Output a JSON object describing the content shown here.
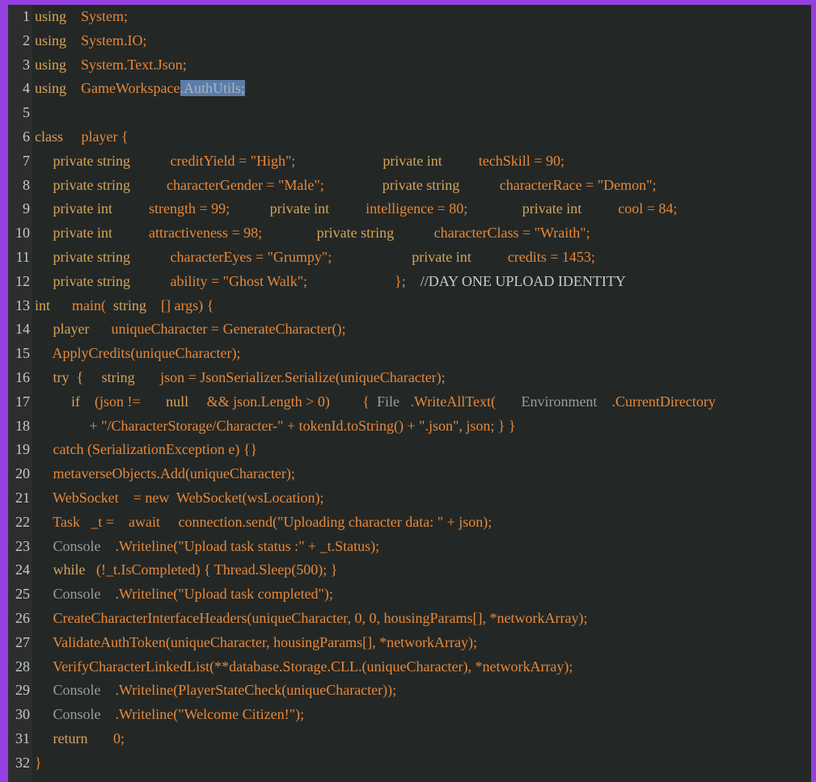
{
  "theme": {
    "frame": "#9440e0",
    "background": "#232826",
    "gutter": "#2b2e2d",
    "keyword": "#d9a25a",
    "identifier": "#e8873a",
    "type_gray": "#9a9d9b",
    "selection": "#5b7ca8"
  },
  "lines": [
    {
      "n": "1",
      "tokens": [
        [
          "kw",
          "using    "
        ],
        [
          "id",
          "System;"
        ]
      ]
    },
    {
      "n": "2",
      "tokens": [
        [
          "kw",
          "using    "
        ],
        [
          "id",
          "System.IO;"
        ]
      ]
    },
    {
      "n": "3",
      "tokens": [
        [
          "kw",
          "using    "
        ],
        [
          "id",
          "System.Text.Json;"
        ]
      ]
    },
    {
      "n": "4",
      "tokens": [
        [
          "kw",
          "using    "
        ],
        [
          "id",
          "GameWorkspace"
        ],
        [
          "sel",
          ".AuthUtils;"
        ]
      ]
    },
    {
      "n": "5",
      "tokens": []
    },
    {
      "n": "6",
      "tokens": [
        [
          "kw",
          "class     "
        ],
        [
          "id",
          "player {"
        ]
      ]
    },
    {
      "n": "7",
      "tokens": [
        [
          "kw",
          "     private string           "
        ],
        [
          "id",
          "creditYield = \"High\";"
        ],
        [
          "kw",
          "                        private int          "
        ],
        [
          "id",
          "techSkill = 90;"
        ]
      ]
    },
    {
      "n": "8",
      "tokens": [
        [
          "kw",
          "     private string          "
        ],
        [
          "id",
          "characterGender = \"Male\";"
        ],
        [
          "kw",
          "                private string           "
        ],
        [
          "id",
          "characterRace = \"Demon\";"
        ]
      ]
    },
    {
      "n": "9",
      "tokens": [
        [
          "kw",
          "     private int          "
        ],
        [
          "id",
          "strength = 99;"
        ],
        [
          "kw",
          "           private int          "
        ],
        [
          "id",
          "intelligence = 80;"
        ],
        [
          "kw",
          "               private int          "
        ],
        [
          "id",
          "cool = 84;"
        ]
      ]
    },
    {
      "n": "10",
      "tokens": [
        [
          "kw",
          "     private int          "
        ],
        [
          "id",
          "attractiveness = 98;"
        ],
        [
          "kw",
          "               private string           "
        ],
        [
          "id",
          "characterClass = \"Wraith\";"
        ]
      ]
    },
    {
      "n": "11",
      "tokens": [
        [
          "kw",
          "     private string           "
        ],
        [
          "id",
          "characterEyes = \"Grumpy\";"
        ],
        [
          "kw",
          "                      private int          "
        ],
        [
          "id",
          "credits = 1453;"
        ]
      ]
    },
    {
      "n": "12",
      "tokens": [
        [
          "kw",
          "     private string           "
        ],
        [
          "id",
          "ability = \"Ghost Walk\";"
        ],
        [
          "id",
          "                        };    "
        ],
        [
          "comment",
          "//DAY ONE UPLOAD IDENTITY"
        ]
      ]
    },
    {
      "n": "13",
      "tokens": [
        [
          "kw",
          "int      "
        ],
        [
          "id",
          "main(  "
        ],
        [
          "kw",
          "string    "
        ],
        [
          "id",
          "[] args) {"
        ]
      ]
    },
    {
      "n": "14",
      "tokens": [
        [
          "kw",
          "     player      "
        ],
        [
          "id",
          "uniqueCharacter = GenerateCharacter();"
        ]
      ]
    },
    {
      "n": "15",
      "tokens": [
        [
          "id",
          "     ApplyCredits(uniqueCharacter);"
        ]
      ]
    },
    {
      "n": "16",
      "tokens": [
        [
          "kw",
          "     try  {     string       "
        ],
        [
          "id",
          "json = JsonSerializer.Serialize(uniqueCharacter);"
        ]
      ]
    },
    {
      "n": "17",
      "tokens": [
        [
          "kw",
          "          if    "
        ],
        [
          "id",
          "(json !=       "
        ],
        [
          "kw",
          "null     "
        ],
        [
          "id",
          "&& json.Length > 0)         {  "
        ],
        [
          "gray",
          "File   "
        ],
        [
          "id",
          ".WriteAllText(       "
        ],
        [
          "gray",
          "Environment    "
        ],
        [
          "id",
          ".CurrentDirectory"
        ]
      ]
    },
    {
      "n": "18",
      "tokens": [
        [
          "id",
          "               + \"/CharacterStorage/Character-\" + tokenId.toString() + \".json\", json; } }"
        ]
      ]
    },
    {
      "n": "19",
      "tokens": [
        [
          "id",
          "     catch (SerializationException e) {}"
        ]
      ]
    },
    {
      "n": "20",
      "tokens": [
        [
          "id",
          "     metaverseObjects.Add(uniqueCharacter);"
        ]
      ]
    },
    {
      "n": "21",
      "tokens": [
        [
          "id",
          "     WebSocket    = new  WebSocket(wsLocation);"
        ]
      ]
    },
    {
      "n": "22",
      "tokens": [
        [
          "id",
          "     Task   _t =    await     connection.send(\"Uploading character data: \" + json);"
        ]
      ]
    },
    {
      "n": "23",
      "tokens": [
        [
          "gray",
          "     Console    "
        ],
        [
          "id",
          ".Writeline(\"Upload task status :\" + _t.Status);"
        ]
      ]
    },
    {
      "n": "24",
      "tokens": [
        [
          "kw",
          "     while   "
        ],
        [
          "id",
          "(!_t.IsCompleted) { Thread.Sleep(500); }"
        ]
      ]
    },
    {
      "n": "25",
      "tokens": [
        [
          "gray",
          "     Console    "
        ],
        [
          "id",
          ".Writeline(\"Upload task completed\");"
        ]
      ]
    },
    {
      "n": "26",
      "tokens": [
        [
          "id",
          "     CreateCharacterInterfaceHeaders(uniqueCharacter, 0, 0, housingParams[], *networkArray);"
        ]
      ]
    },
    {
      "n": "27",
      "tokens": [
        [
          "id",
          "     ValidateAuthToken(uniqueCharacter, housingParams[], *networkArray);"
        ]
      ]
    },
    {
      "n": "28",
      "tokens": [
        [
          "id",
          "     VerifyCharacterLinkedList(**database.Storage.CLL.(uniqueCharacter), *networkArray);"
        ]
      ]
    },
    {
      "n": "29",
      "tokens": [
        [
          "gray",
          "     Console    "
        ],
        [
          "id",
          ".Writeline(PlayerStateCheck(uniqueCharacter));"
        ]
      ]
    },
    {
      "n": "30",
      "tokens": [
        [
          "gray",
          "     Console    "
        ],
        [
          "id",
          ".Writeline(\"Welcome Citizen!\");"
        ]
      ]
    },
    {
      "n": "31",
      "tokens": [
        [
          "kw",
          "     return       "
        ],
        [
          "id",
          "0;"
        ]
      ]
    },
    {
      "n": "32",
      "tokens": [
        [
          "id",
          "}"
        ]
      ]
    }
  ]
}
